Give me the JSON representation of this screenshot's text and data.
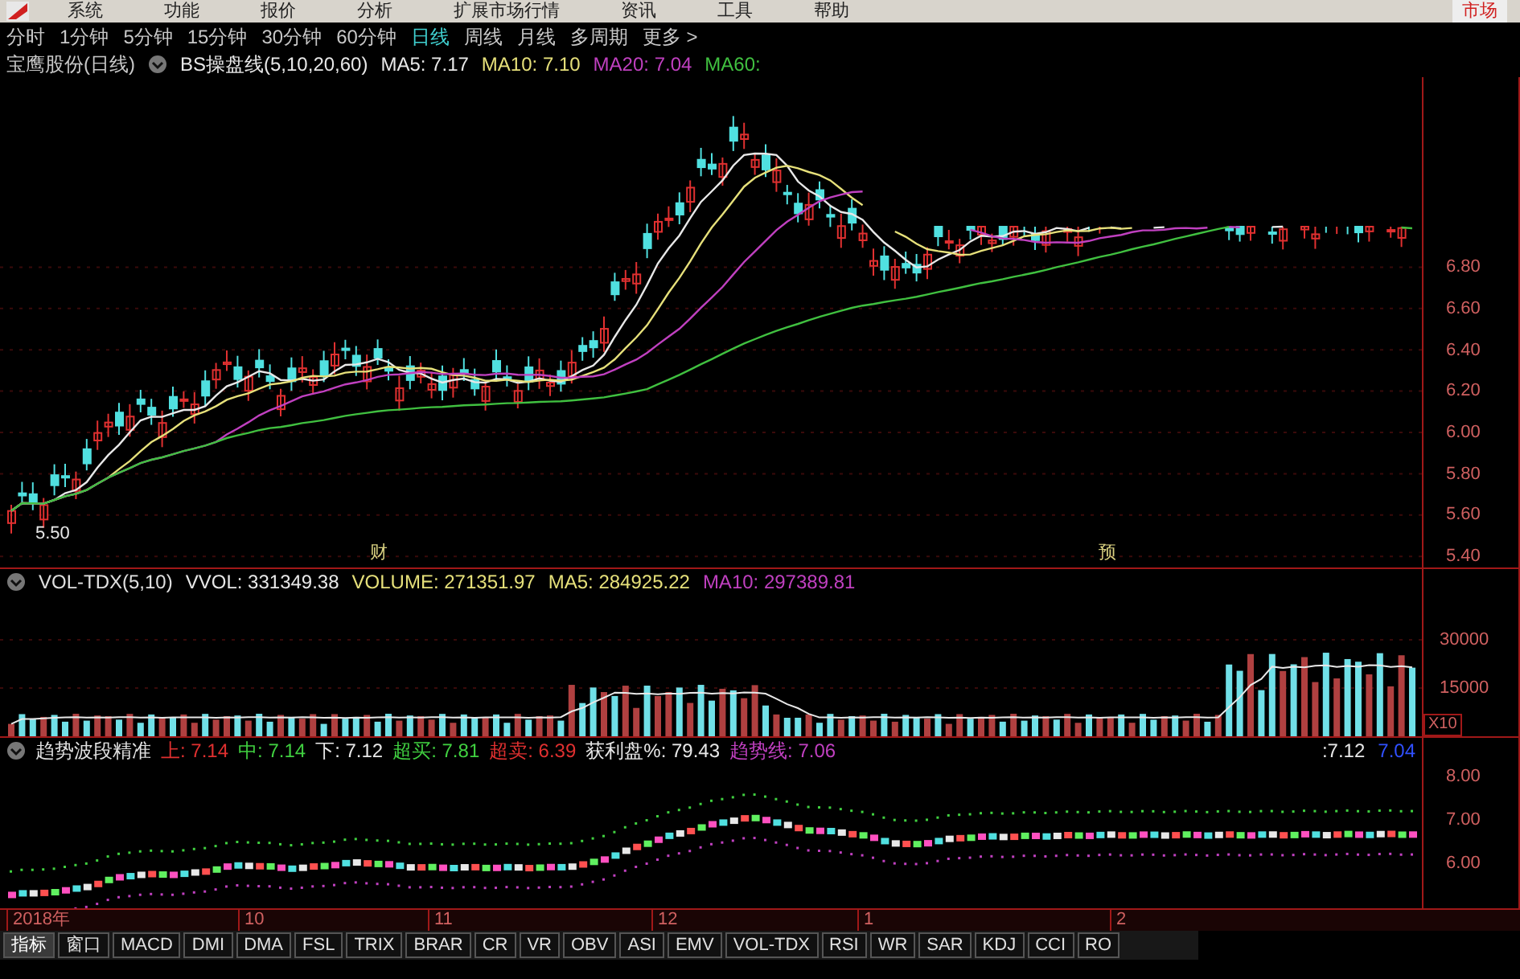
{
  "menu": {
    "items": [
      "系统",
      "功能",
      "报价",
      "分析",
      "扩展市场行情",
      "资讯",
      "工具",
      "帮助"
    ],
    "right_button": "市场"
  },
  "periods": [
    {
      "label": "分时",
      "selected": false
    },
    {
      "label": "1分钟",
      "selected": false
    },
    {
      "label": "5分钟",
      "selected": false
    },
    {
      "label": "15分钟",
      "selected": false
    },
    {
      "label": "30分钟",
      "selected": false
    },
    {
      "label": "60分钟",
      "selected": false
    },
    {
      "label": "日线",
      "selected": true
    },
    {
      "label": "周线",
      "selected": false
    },
    {
      "label": "月线",
      "selected": false
    },
    {
      "label": "多周期",
      "selected": false
    },
    {
      "label": "更多 >",
      "selected": false
    }
  ],
  "main_chart": {
    "stock": "宝鹰股份(日线)",
    "indicator": "BS操盘线(5,10,20,60)",
    "readings": [
      {
        "text": "MA5: 7.17",
        "color": "#e8e8e8"
      },
      {
        "text": "MA10: 7.10",
        "color": "#e6e07a"
      },
      {
        "text": "MA20: 7.04",
        "color": "#c040c0"
      },
      {
        "text": "MA60:",
        "color": "#40c040"
      }
    ],
    "low_label": "5.50",
    "event_marks": [
      "财",
      "预"
    ],
    "yticks": [
      "6.80",
      "6.60",
      "6.40",
      "6.20",
      "6.00",
      "5.80",
      "5.60",
      "5.40"
    ]
  },
  "volume_panel": {
    "indicator": "VOL-TDX(5,10)",
    "readings": [
      {
        "text": "VVOL: 331349.38",
        "color": "#e8e8e8"
      },
      {
        "text": "VOLUME: 271351.97",
        "color": "#e6e07a"
      },
      {
        "text": "MA5: 284925.22",
        "color": "#e6e07a"
      },
      {
        "text": "MA10: 297389.81",
        "color": "#c040c0"
      }
    ],
    "yticks": [
      "30000",
      "15000"
    ],
    "unit": "X10"
  },
  "trend_panel": {
    "indicator": "趋势波段精准",
    "readings": [
      {
        "label": "上:",
        "value": "7.14",
        "color": "#e03030"
      },
      {
        "label": "中:",
        "value": "7.14",
        "color": "#40d040"
      },
      {
        "label": "下:",
        "value": "7.12",
        "color": "#e8e8e8"
      },
      {
        "label": "超买:",
        "value": "7.81",
        "color": "#40d040"
      },
      {
        "label": "超卖:",
        "value": "6.39",
        "color": "#e03030"
      },
      {
        "label": "获利盘%:",
        "value": "79.43",
        "color": "#e8e8e8"
      },
      {
        "label": "趋势线:",
        "value": "7.06",
        "color": "#c040c0"
      }
    ],
    "right_readings": [
      {
        "text": ":7.12",
        "color": "#e8e8e8"
      },
      {
        "text": "7.04",
        "color": "#3050ff"
      }
    ],
    "yticks": [
      "8.00",
      "7.00",
      "6.00"
    ]
  },
  "date_axis": [
    "2018年",
    "10",
    "11",
    "12",
    "1",
    "2"
  ],
  "tabs": [
    {
      "label": "指标",
      "selected": true
    },
    {
      "label": "窗口",
      "selected": false
    },
    {
      "label": "MACD",
      "selected": false
    },
    {
      "label": "DMI",
      "selected": false
    },
    {
      "label": "DMA",
      "selected": false
    },
    {
      "label": "FSL",
      "selected": false
    },
    {
      "label": "TRIX",
      "selected": false
    },
    {
      "label": "BRAR",
      "selected": false
    },
    {
      "label": "CR",
      "selected": false
    },
    {
      "label": "VR",
      "selected": false
    },
    {
      "label": "OBV",
      "selected": false
    },
    {
      "label": "ASI",
      "selected": false
    },
    {
      "label": "EMV",
      "selected": false
    },
    {
      "label": "VOL-TDX",
      "selected": false
    },
    {
      "label": "RSI",
      "selected": false
    },
    {
      "label": "WR",
      "selected": false
    },
    {
      "label": "SAR",
      "selected": false
    },
    {
      "label": "KDJ",
      "selected": false
    },
    {
      "label": "CCI",
      "selected": false
    },
    {
      "label": "RO",
      "selected": false
    }
  ]
}
